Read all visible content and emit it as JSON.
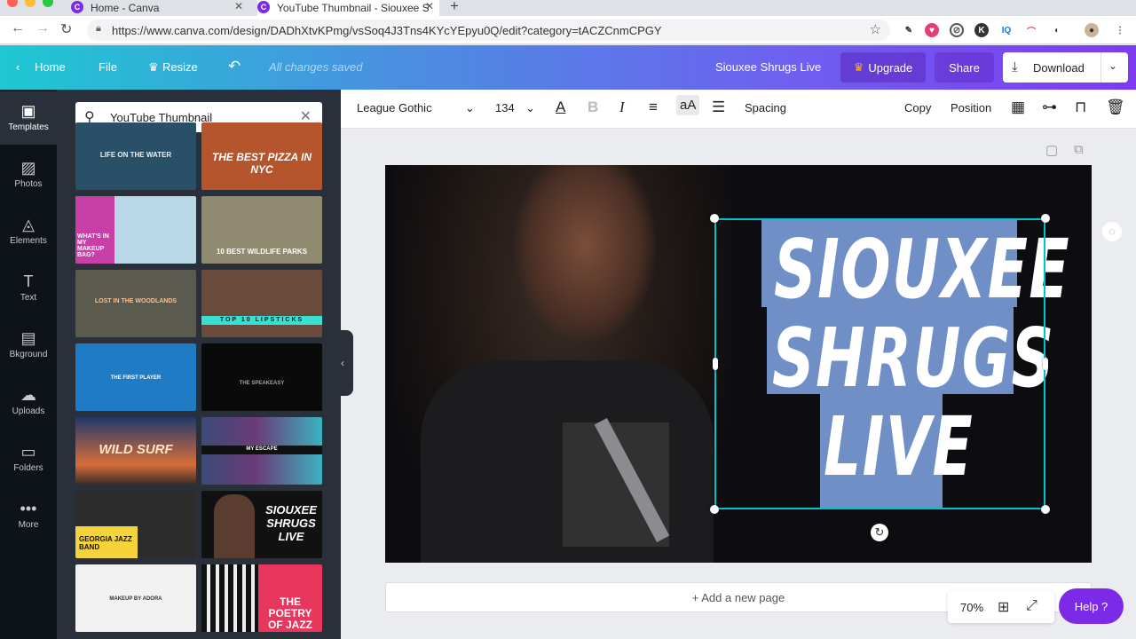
{
  "browser": {
    "tabs": [
      {
        "title": "Home - Canva",
        "favicon": "C"
      },
      {
        "title": "YouTube Thumbnail - Siouxee S",
        "favicon": "C"
      }
    ],
    "url": "https://www.canva.com/design/DADhXtvKPmg/vsSoq4J3Tns4KYcYEpyu0Q/edit?category=tACZCnmCPGY"
  },
  "header": {
    "home": "Home",
    "file": "File",
    "resize": "Resize",
    "saved_status": "All changes saved",
    "design_title": "Siouxee Shrugs Live",
    "upgrade": "Upgrade",
    "share": "Share",
    "download": "Download"
  },
  "rail": [
    {
      "label": "Templates",
      "icon": "templates-icon"
    },
    {
      "label": "Photos",
      "icon": "photos-icon"
    },
    {
      "label": "Elements",
      "icon": "elements-icon"
    },
    {
      "label": "Text",
      "icon": "text-icon"
    },
    {
      "label": "Bkground",
      "icon": "background-icon"
    },
    {
      "label": "Uploads",
      "icon": "uploads-icon"
    },
    {
      "label": "Folders",
      "icon": "folders-icon"
    },
    {
      "label": "More",
      "icon": "more-icon"
    }
  ],
  "search": {
    "value": "YouTube Thumbnail"
  },
  "templates": [
    {
      "text": "LIFE ON THE WATER",
      "bg": "#2a5068",
      "fg": "#e8f1f5"
    },
    {
      "text": "THE BEST PIZZA IN NYC",
      "bg": "#b4552d",
      "fg": "#ffffff"
    },
    {
      "text": "WHAT'S IN MY MAKEUP BAG?",
      "bg": "#b9d7e6",
      "fg": "#ffffff"
    },
    {
      "text": "10 BEST WILDLIFE PARKS",
      "bg": "#8f8a70",
      "fg": "#ffffff"
    },
    {
      "text": "LOST IN THE WOODLANDS",
      "bg": "#5b5a4e",
      "fg": "#f0c49a"
    },
    {
      "text": "TOP 10 LIPSTICKS",
      "bg": "#6a4a3a",
      "fg": "#111111"
    },
    {
      "text": "THE FIRST PLAYER",
      "bg": "#1f7bc4",
      "fg": "#ffffff"
    },
    {
      "text": "THE SPEAKEASY",
      "bg": "#0a0a0a",
      "fg": "#9aa49a"
    },
    {
      "text": "WILD SURF",
      "bg": "#b35a3c",
      "fg": "#ffe4c8"
    },
    {
      "text": "MY ESCAPE",
      "bg": "#3b4b77",
      "fg": "#ffffff"
    },
    {
      "text": "GEORGIA JAZZ BAND",
      "bg": "#2c2c2c",
      "fg": "#111111"
    },
    {
      "text": "SIOUXEE SHRUGS LIVE",
      "bg": "#111111",
      "fg": "#ffffff"
    },
    {
      "text": "MAKEUP BY ADORA",
      "bg": "#f2f2f2",
      "fg": "#333333"
    },
    {
      "text": "THE POETRY OF JAZZ",
      "bg": "#e8365d",
      "fg": "#ffffff"
    }
  ],
  "toolbar": {
    "font": "League Gothic",
    "size": "134",
    "case": "aA",
    "spacing": "Spacing",
    "copy": "Copy",
    "position": "Position"
  },
  "canvas": {
    "lines": [
      "SIOUXEE",
      "SHRUGS",
      "LIVE"
    ],
    "highlight_color": "#6f8fc6",
    "selection_color": "#00c4cc"
  },
  "footer": {
    "add_page": "+ Add a new page",
    "zoom": "70%",
    "help": "Help ?"
  },
  "colors": {
    "accent": "#7d2ae8",
    "rail_bg": "#0e1318",
    "panel_bg": "#293039"
  }
}
